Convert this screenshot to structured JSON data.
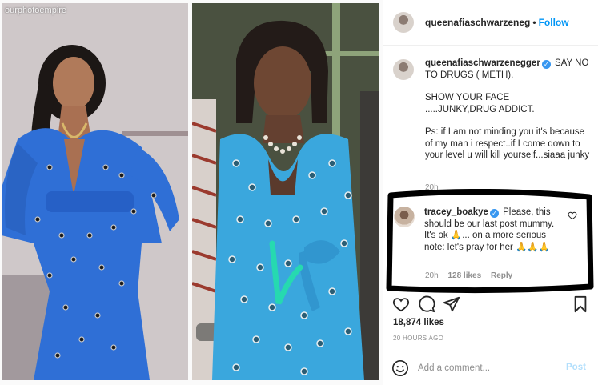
{
  "media": {
    "watermark": "ourphotoempire",
    "scribble_color": "#26d9b0"
  },
  "header": {
    "username": "queenafiaschwarzeneg",
    "separator": "•",
    "follow_label": "Follow"
  },
  "caption": {
    "username": "queenafiaschwarzenegger",
    "lines": [
      "SAY NO TO DRUGS ( METH).",
      "SHOW YOUR FACE\n.....JUNKY,DRUG ADDICT.",
      "Ps: if I am not minding you it's because of my man i respect..if I come down to your level u will kill yourself...siaaa junky"
    ],
    "time": "20h"
  },
  "comment": {
    "username": "tracey_boakye",
    "text": "Please, this should be our last post mummy. It's ok 🙏... on a more serious note: let's pray for her 🙏🙏🙏",
    "time": "20h",
    "likes": "128 likes",
    "reply_label": "Reply"
  },
  "actions": {
    "icons": [
      "heart-icon",
      "comment-icon",
      "share-icon",
      "bookmark-icon"
    ]
  },
  "stats": {
    "likes": "18,874 likes",
    "posted": "20 HOURS AGO"
  },
  "comment_bar": {
    "placeholder": "Add a comment...",
    "post_label": "Post"
  },
  "colors": {
    "accent": "#0095f6",
    "verified": "#3897f0",
    "muted": "#8e8e8e",
    "post_disabled": "#b2dffc"
  }
}
